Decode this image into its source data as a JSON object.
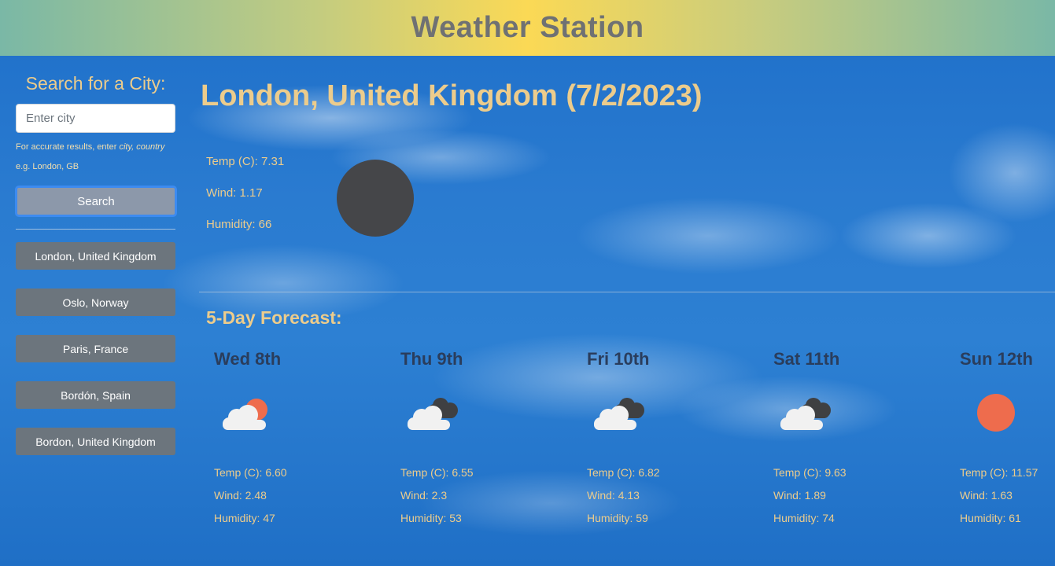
{
  "header": {
    "title": "Weather Station"
  },
  "sidebar": {
    "heading": "Search for a City:",
    "search": {
      "placeholder": "Enter city",
      "value": ""
    },
    "hint_prefix": "For accurate results, enter ",
    "hint_emphasis": "city, country",
    "hint_example": "e.g. London, GB",
    "search_button": "Search",
    "history": [
      "London, United Kingdom",
      "Oslo, Norway",
      "Paris, France",
      "Bordón, Spain",
      "Bordon, United Kingdom"
    ]
  },
  "current": {
    "title": "London, United Kingdom (7/2/2023)",
    "temp": "Temp (C): 7.31",
    "wind": "Wind: 1.17",
    "humidity": "Humidity: 66",
    "icon": "night-circle-icon"
  },
  "forecast": {
    "heading": "5-Day Forecast:",
    "days": [
      {
        "day": "Wed 8th",
        "icon": "partly-sunny-icon",
        "temp": "Temp (C): 6.60",
        "wind": "Wind: 2.48",
        "humidity": "Humidity: 47"
      },
      {
        "day": "Thu 9th",
        "icon": "cloudy-icon",
        "temp": "Temp (C): 6.55",
        "wind": "Wind: 2.3",
        "humidity": "Humidity: 53"
      },
      {
        "day": "Fri 10th",
        "icon": "cloudy-icon",
        "temp": "Temp (C): 6.82",
        "wind": "Wind: 4.13",
        "humidity": "Humidity: 59"
      },
      {
        "day": "Sat 11th",
        "icon": "cloudy-icon",
        "temp": "Temp (C): 9.63",
        "wind": "Wind: 1.89",
        "humidity": "Humidity: 74"
      },
      {
        "day": "Sun 12th",
        "icon": "sunny-icon",
        "temp": "Temp (C): 11.57",
        "wind": "Wind: 1.63",
        "humidity": "Humidity: 61"
      }
    ]
  },
  "colors": {
    "accent_text": "#eccc8c",
    "day_label": "#2a3d5c",
    "city_button": "#6c757d",
    "search_button": "#8c98aa",
    "sun": "#ee6c4d",
    "night_circle": "#454649"
  }
}
